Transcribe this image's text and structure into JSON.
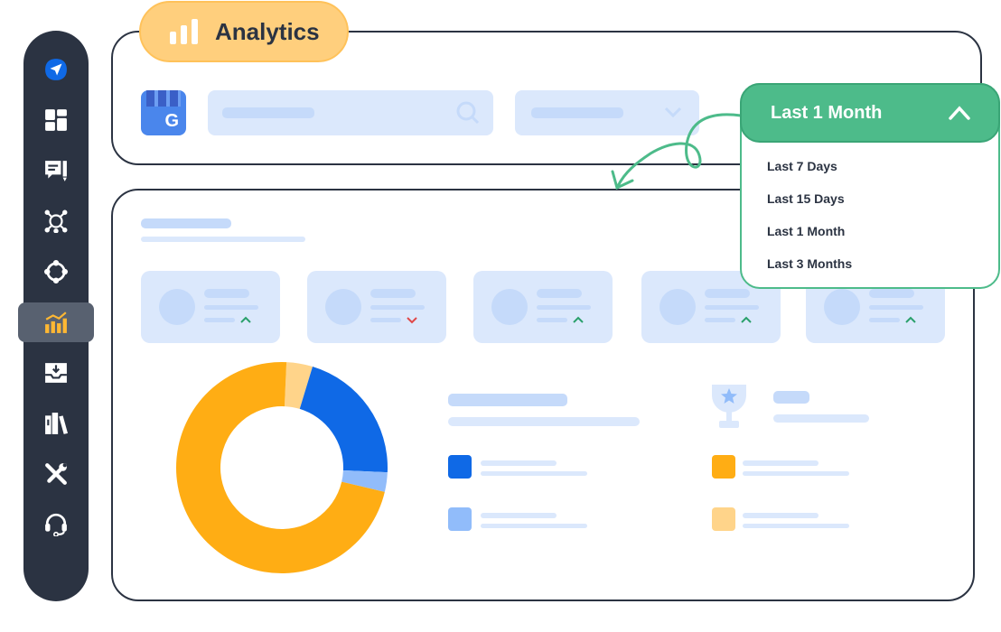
{
  "header": {
    "title": "Analytics",
    "icon": "bar-chart-icon"
  },
  "sidebar": {
    "items": [
      {
        "icon": "paper-plane-icon"
      },
      {
        "icon": "dashboard-icon"
      },
      {
        "icon": "chat-edit-icon"
      },
      {
        "icon": "network-icon"
      },
      {
        "icon": "cycle-icon"
      },
      {
        "icon": "analytics-icon",
        "active": true
      },
      {
        "icon": "inbox-download-icon"
      },
      {
        "icon": "library-icon"
      },
      {
        "icon": "tools-icon"
      },
      {
        "icon": "headset-icon"
      }
    ]
  },
  "date_dropdown": {
    "selected": "Last 1 Month",
    "options": [
      "Last 7 Days",
      "Last 15 Days",
      "Last 1 Month",
      "Last 3 Months"
    ]
  },
  "colors": {
    "accent": "#4dbb8a",
    "sidebar": "#2b3342",
    "orange": "#ffad14",
    "light_orange": "#ffd48a",
    "blue": "#0f69e6",
    "light_blue": "#91bcfa",
    "highlight": "#ffcf7d"
  },
  "stat_cards": [
    {
      "trend": "up"
    },
    {
      "trend": "down"
    },
    {
      "trend": "up"
    },
    {
      "trend": "up"
    },
    {
      "trend": "up"
    }
  ],
  "chart_data": {
    "type": "pie",
    "segments": [
      {
        "color": "#ffd48a",
        "value": 4
      },
      {
        "color": "#0f69e6",
        "value": 21
      },
      {
        "color": "#91bcfa",
        "value": 3
      },
      {
        "color": "#ffad14",
        "value": 72
      }
    ]
  }
}
